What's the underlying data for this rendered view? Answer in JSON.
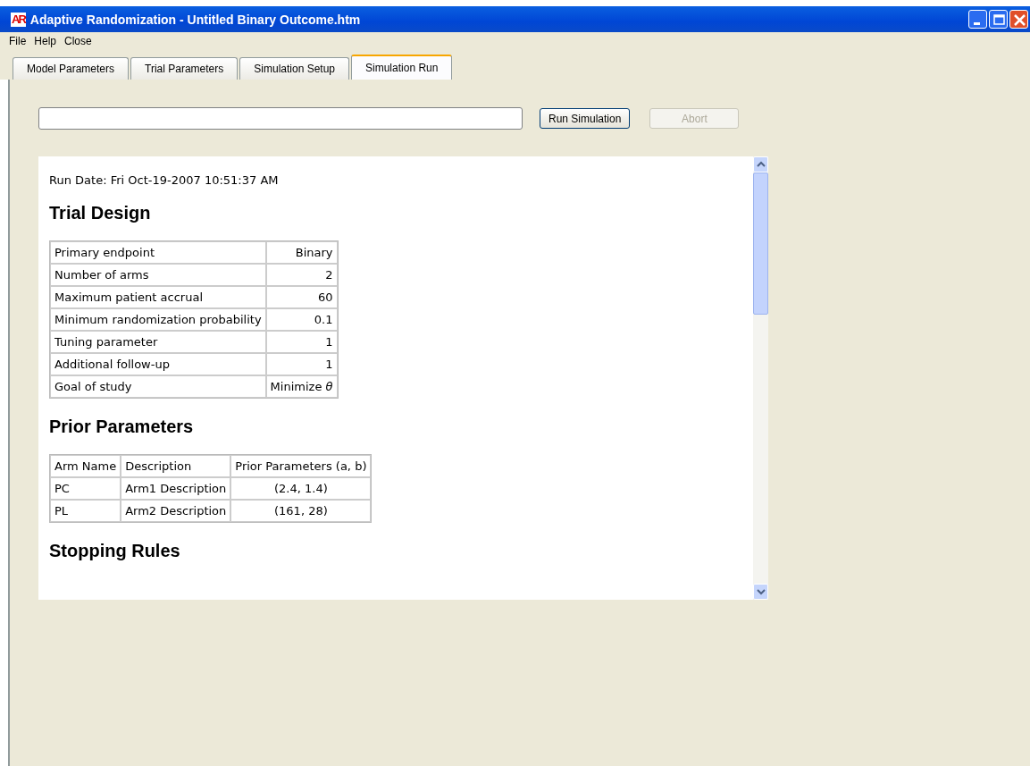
{
  "window": {
    "logo": "AR",
    "title": "Adaptive Randomization - Untitled Binary Outcome.htm"
  },
  "menu": [
    "File",
    "Help",
    "Close"
  ],
  "tabs": [
    {
      "label": "Model Parameters",
      "selected": false
    },
    {
      "label": "Trial Parameters",
      "selected": false
    },
    {
      "label": "Simulation Setup",
      "selected": false
    },
    {
      "label": "Simulation Run",
      "selected": true
    }
  ],
  "progress": {
    "level": 0
  },
  "buttons": [
    {
      "label": "Run Simulation",
      "disabled": false
    },
    {
      "label": "Abort",
      "disabled": true
    }
  ],
  "report": {
    "run_date": "Run Date: Fri Oct-19-2007 10:51:37 AM",
    "sections": [
      {
        "heading": "Trial Design",
        "kind": "keyvalue",
        "rows": [
          [
            "Primary endpoint",
            "Binary"
          ],
          [
            "Number of arms",
            "2"
          ],
          [
            "Maximum patient accrual",
            "60"
          ],
          [
            "Minimum randomization probability",
            "0.1"
          ],
          [
            "Tuning parameter",
            "1"
          ],
          [
            "Additional follow-up",
            "1"
          ],
          [
            "Goal of study",
            "Minimize *θ*"
          ]
        ]
      },
      {
        "heading": "Prior Parameters",
        "kind": "grid",
        "columns": [
          "Arm Name",
          "Description",
          "Prior Parameters (a, b)"
        ],
        "rows": [
          [
            "PC",
            "Arm1 Description",
            "(2.4, 1.4)"
          ],
          [
            "PL",
            "Arm2 Description",
            "(161, 28)"
          ]
        ]
      },
      {
        "heading": "Stopping Rules",
        "kind": "heading"
      }
    ]
  }
}
